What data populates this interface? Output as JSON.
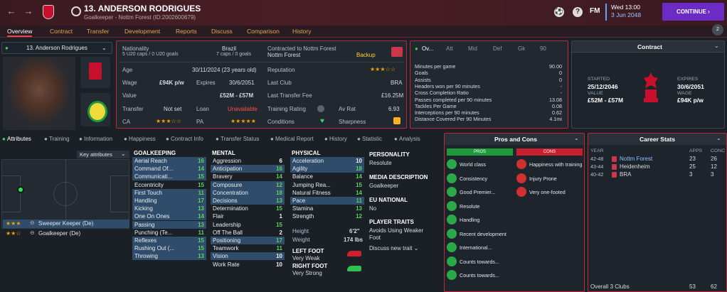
{
  "header": {
    "name": "13. ANDERSON RODRIGUES",
    "subtitle": "Goalkeeper - Nottm Forest (ID:2002600679)",
    "date": "Wed 13:00",
    "date2": "3 Jun 2048",
    "continue": "CONTINUE",
    "fm": "FM",
    "notif_count": "2"
  },
  "tabs": [
    "Overview",
    "Contract",
    "Transfer",
    "Development",
    "Reports",
    "Discuss",
    "Comparison",
    "History"
  ],
  "profile": {
    "selector": "13. Anderson Rodrigues"
  },
  "info": {
    "nationality_label": "Nationality",
    "nationality": "Brazil",
    "caps": "5 U20 caps / 0 U20 goals",
    "caps2": "7 caps / 0 goals",
    "contracted_label": "Contracted to Nottm Forest",
    "club": "Nottm Forest",
    "squad_status": "Backup",
    "age_label": "Age",
    "age": "30/11/2024 (23 years old)",
    "reputation_label": "Reputation",
    "reputation_stars": "★★★☆☆",
    "wage_label": "Wage",
    "wage": "£94K p/w",
    "expires_label": "Expires",
    "expires": "30/6/2051",
    "lastclub_label": "Last Club",
    "lastclub": "BRA",
    "value_label": "Value",
    "value": "£52M - £57M",
    "ltf_label": "Last Transfer Fee",
    "ltf": "£16.25M",
    "transfer_label": "Transfer",
    "transfer": "Not set",
    "loan_label": "Loan",
    "loan": "Unavailable",
    "training_label": "Training Rating",
    "avrat_label": "Av Rat",
    "avrat": "6.93",
    "ca_label": "CA",
    "ca_stars": "★★★☆☆",
    "pa_label": "PA",
    "pa_stars": "★★★★★",
    "conditions_label": "Conditions",
    "sharpness_label": "Sharpness"
  },
  "stats": {
    "subtabs": [
      "Ov...",
      "Att",
      "Mid",
      "Def",
      "Gk",
      "90"
    ],
    "rows": [
      [
        "Minutes per game",
        "90.00"
      ],
      [
        "Goals",
        "0"
      ],
      [
        "Assists",
        "0"
      ],
      [
        "Headers won per 90 minutes",
        "-"
      ],
      [
        "Cross Completion Ratio",
        "-"
      ],
      [
        "Passes completed per 90 minutes",
        "13.08"
      ],
      [
        "Tackles Per Game",
        "0.08"
      ],
      [
        "Interceptions per 90 minutes",
        "0.62"
      ],
      [
        "Distance Covered Per 90 Minutes",
        "4.1mi"
      ]
    ]
  },
  "contract": {
    "title": "Contract",
    "started_label": "STARTED",
    "started": "25/12/2046",
    "value_label": "VALUE",
    "value": "£52M - £57M",
    "expires_label": "EXPIRES",
    "expires": "30/6/2051",
    "wage_label": "WAGE",
    "wage": "£94K p/w"
  },
  "attrtabs": [
    "Attributes",
    "Training",
    "Information",
    "Happiness",
    "Contract Info",
    "Transfer Status",
    "Medical Report",
    "History",
    "Statistic",
    "Analysis"
  ],
  "key_attributes": "Key attributes",
  "roles": [
    {
      "stars": "★★★",
      "name": "Sweeper Keeper (De)"
    },
    {
      "stars": "★★☆",
      "name": "Goalkeeper (De)"
    }
  ],
  "goalkeeping": {
    "title": "GOALKEEPING",
    "rows": [
      [
        "Aerial Reach",
        "16",
        "green",
        true
      ],
      [
        "Command Of...",
        "14",
        "green",
        true
      ],
      [
        "Communicati...",
        "15",
        "green",
        true
      ],
      [
        "Eccentricity",
        "15",
        "green",
        false
      ],
      [
        "First Touch",
        "11",
        "green",
        true
      ],
      [
        "Handling",
        "17",
        "green",
        true
      ],
      [
        "Kicking",
        "13",
        "green",
        true
      ],
      [
        "One On Ones",
        "14",
        "green",
        true
      ],
      [
        "Passing",
        "13",
        "green",
        true
      ],
      [
        "Punching (Te...",
        "11",
        "green",
        false
      ],
      [
        "Reflexes",
        "15",
        "green",
        true
      ],
      [
        "Rushing Out (...",
        "15",
        "green",
        true
      ],
      [
        "Throwing",
        "13",
        "green",
        true
      ]
    ]
  },
  "mental": {
    "title": "MENTAL",
    "rows": [
      [
        "Aggression",
        "6",
        "white",
        false
      ],
      [
        "Anticipation",
        "16",
        "green",
        true
      ],
      [
        "Bravery",
        "14",
        "green",
        false
      ],
      [
        "Composure",
        "12",
        "green",
        true
      ],
      [
        "Concentration",
        "18",
        "green",
        true
      ],
      [
        "Decisions",
        "13",
        "green",
        true
      ],
      [
        "Determination",
        "15",
        "green",
        false
      ],
      [
        "Flair",
        "1",
        "white",
        false
      ],
      [
        "Leadership",
        "15",
        "green",
        false
      ],
      [
        "Off The Ball",
        "2",
        "white",
        false
      ],
      [
        "Positioning",
        "17",
        "green",
        true
      ],
      [
        "Teamwork",
        "11",
        "green",
        false
      ],
      [
        "Vision",
        "10",
        "white",
        true
      ],
      [
        "Work Rate",
        "10",
        "white",
        false
      ]
    ]
  },
  "physical": {
    "title": "PHYSICAL",
    "rows": [
      [
        "Acceleration",
        "10",
        "white",
        true
      ],
      [
        "Agility",
        "18",
        "green",
        true
      ],
      [
        "Balance",
        "14",
        "green",
        false
      ],
      [
        "Jumping Rea...",
        "15",
        "green",
        false
      ],
      [
        "Natural Fitness",
        "14",
        "green",
        false
      ],
      [
        "Pace",
        "11",
        "green",
        true
      ],
      [
        "Stamina",
        "13",
        "green",
        false
      ],
      [
        "Strength",
        "12",
        "green",
        false
      ]
    ],
    "height_label": "Height",
    "height": "6'2\"",
    "weight_label": "Weight",
    "weight": "174 lbs",
    "leftfoot_label": "LEFT FOOT",
    "leftfoot": "Very Weak",
    "rightfoot_label": "RIGHT FOOT",
    "rightfoot": "Very Strong"
  },
  "personality": {
    "title": "PERSONALITY",
    "value": "Resolute",
    "media_title": "MEDIA DESCRIPTION",
    "media": "Goalkeeper",
    "eu_title": "EU NATIONAL",
    "eu": "No",
    "traits_title": "PLAYER TRAITS",
    "trait1": "Avoids Using Weaker",
    "trait1b": "Foot",
    "discuss": "Discuss new trait"
  },
  "proscons": {
    "title": "Pros and Cons",
    "pros_label": "PROS",
    "cons_label": "CONS",
    "pros": [
      "World class",
      "Consistency",
      "Good Premier...",
      "Resolute",
      "Handling",
      "Recent development",
      "International...",
      "Counts towards...",
      "Counts towards..."
    ],
    "cons": [
      "Happiness with training",
      "Injury Prone",
      "Very one-footed"
    ]
  },
  "career": {
    "title": "Career Stats",
    "h_year": "YEAR",
    "h_apps": "APPS",
    "h_conc": "CONC",
    "rows": [
      [
        "42-48",
        "Nottm Forest",
        "23",
        "26"
      ],
      [
        "43-44",
        "Heidenheim",
        "25",
        "12"
      ],
      [
        "40-42",
        "BRA",
        "3",
        "3"
      ]
    ],
    "total_label": "Overall 3 Clubs",
    "total_apps": "53",
    "total_conc": "62"
  },
  "colors": {
    "accent": "#c2263a",
    "continue": "#6b2bc4",
    "highlight": "#2f4d6b",
    "green": "#5dd25d",
    "yellow": "#ffd23a"
  }
}
